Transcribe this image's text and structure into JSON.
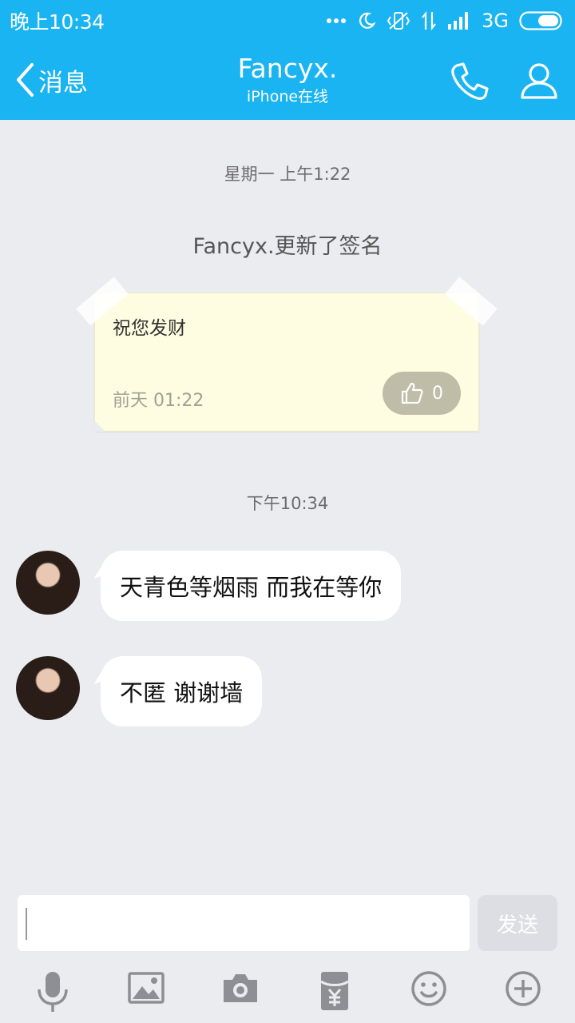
{
  "status_bar": {
    "time": "晚上10:34",
    "network": "3G"
  },
  "header": {
    "back_label": "消息",
    "contact_name": "Fancyx.",
    "contact_status": "iPhone在线"
  },
  "chat": {
    "timestamp_1": "星期一 上午1:22",
    "signature_notice": "Fancyx.更新了签名",
    "signature_card": {
      "text": "祝您发财",
      "date": "前天 01:22",
      "like_count": "0"
    },
    "timestamp_2": "下午10:34",
    "messages": [
      {
        "text": "天青色等烟雨 而我在等你"
      },
      {
        "text": "不匿 谢谢墙"
      }
    ]
  },
  "input": {
    "send_label": "发送"
  },
  "icons": {
    "toolbar": [
      "microphone-icon",
      "image-icon",
      "camera-icon",
      "red-packet-icon",
      "emoji-icon",
      "plus-icon"
    ]
  },
  "colors": {
    "header_bg": "#19b4f1",
    "chat_bg": "#ebecf0",
    "signature_card_bg": "#fefde1",
    "like_button_bg": "#bfbca7"
  }
}
